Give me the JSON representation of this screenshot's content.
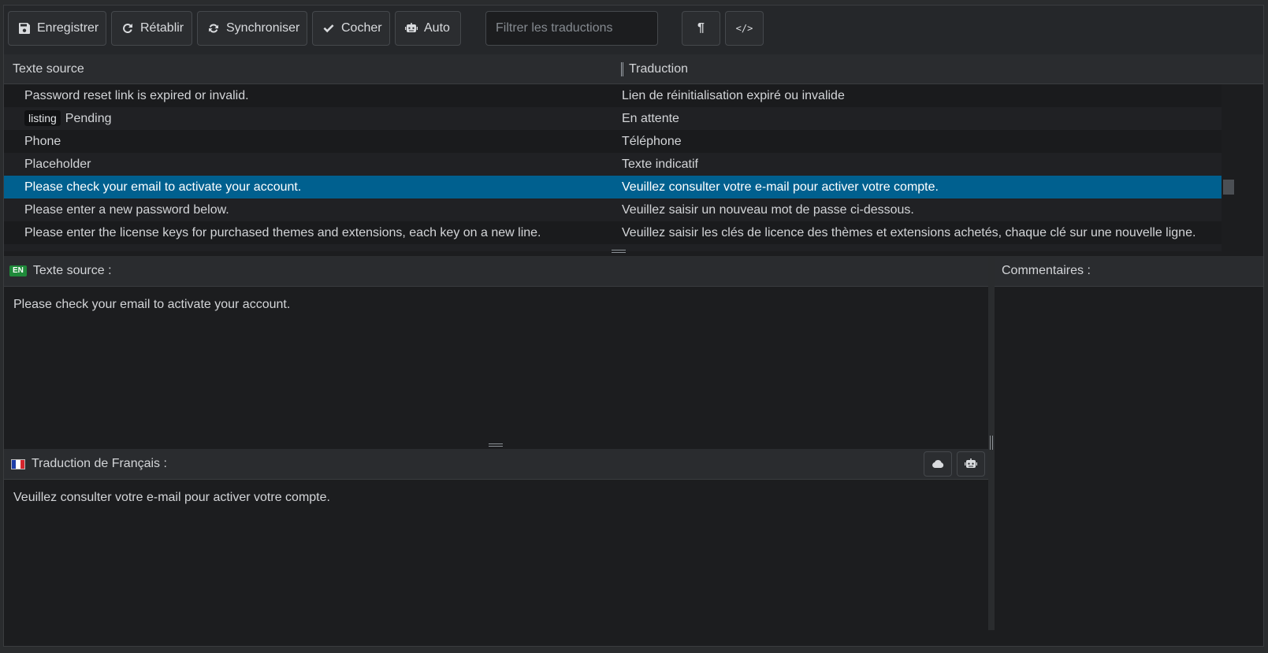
{
  "toolbar": {
    "save_label": "Enregistrer",
    "reset_label": "Rétablir",
    "sync_label": "Synchroniser",
    "check_label": "Cocher",
    "auto_label": "Auto",
    "filter_placeholder": "Filtrer les traductions",
    "pilcrow_glyph": "¶",
    "code_glyph": "</>"
  },
  "table": {
    "col_source": "Texte source",
    "col_translation": "Traduction",
    "rows": [
      {
        "source": "Password reset link is expired or invalid.",
        "translation": "Lien de réinitialisation expiré ou invalide"
      },
      {
        "tag": "listing",
        "source": "Pending",
        "translation": "En attente"
      },
      {
        "source": "Phone",
        "translation": "Téléphone"
      },
      {
        "source": "Placeholder",
        "translation": "Texte indicatif"
      },
      {
        "source": "Please check your email to activate your account.",
        "translation": "Veuillez consulter votre e-mail pour activer votre compte.",
        "selected": true
      },
      {
        "source": "Please enter a new password below.",
        "translation": "Veuillez saisir un nouveau mot de passe ci-dessous."
      },
      {
        "source": "Please enter the license keys for purchased themes and extensions, each key on a new line.",
        "translation": "Veuillez saisir les clés de licence des thèmes et extensions achetés, chaque clé sur une nouvelle ligne."
      }
    ]
  },
  "source_panel": {
    "lang_badge": "EN",
    "title": "Texte source :",
    "text": "Please check your email to activate your account."
  },
  "comments_panel": {
    "title": "Commentaires :"
  },
  "translation_panel": {
    "title": "Traduction de Français :",
    "text": "Veuillez consulter votre e-mail pour activer votre compte."
  },
  "colors": {
    "selected_row": "#00608f",
    "en_badge": "#1f8a3a"
  }
}
